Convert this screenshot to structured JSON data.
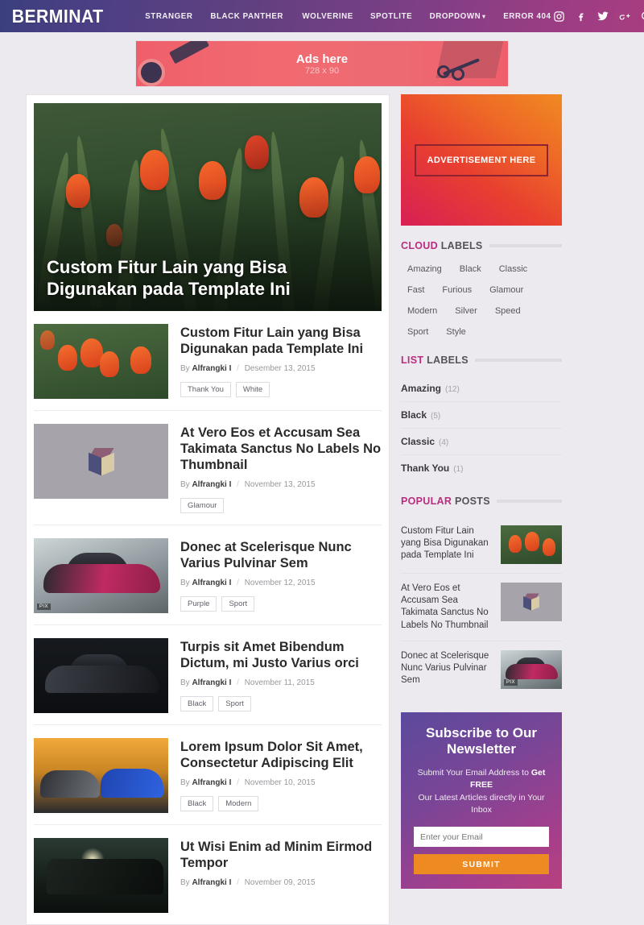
{
  "header": {
    "logo": "BERMINAT",
    "nav": [
      {
        "label": "STRANGER",
        "has_caret": false
      },
      {
        "label": "BLACK PANTHER",
        "has_caret": false
      },
      {
        "label": "WOLVERINE",
        "has_caret": false
      },
      {
        "label": "SPOTLITE",
        "has_caret": false
      },
      {
        "label": "DROPDOWN",
        "has_caret": true
      },
      {
        "label": "ERROR 404",
        "has_caret": false
      }
    ],
    "social": [
      "instagram-icon",
      "facebook-icon",
      "twitter-icon",
      "google-plus-icon",
      "search-icon"
    ],
    "colors": {
      "left": "#3b3f7d",
      "mid": "#604080",
      "right": "#a83d80"
    }
  },
  "top_ad": {
    "title": "Ads here",
    "size": "728 x 90"
  },
  "featured": {
    "title": "Custom Fitur Lain yang Bisa Digunakan pada Template Ini"
  },
  "posts": [
    {
      "title": "Custom Fitur Lain yang Bisa Digunakan pada Template Ini",
      "by": "By",
      "author": "Alfrangki I",
      "date": "Desember 13, 2015",
      "tags": [
        "Thank You",
        "White"
      ],
      "thumb": "tulips-image"
    },
    {
      "title": "At Vero Eos et Accusam Sea Takimata Sanctus No Labels No Thumbnail",
      "by": "By",
      "author": "Alfrangki I",
      "date": "November 13, 2015",
      "tags": [
        "Glamour"
      ],
      "thumb": "cube-placeholder-image"
    },
    {
      "title": "Donec at Scelerisque Nunc Varius Pulvinar Sem",
      "by": "By",
      "author": "Alfrangki I",
      "date": "November 12, 2015",
      "tags": [
        "Purple",
        "Sport"
      ],
      "thumb": "pink-sportscar-image"
    },
    {
      "title": "Turpis sit Amet Bibendum Dictum, mi Justo Varius orci",
      "by": "By",
      "author": "Alfrangki I",
      "date": "November 11, 2015",
      "tags": [
        "Black",
        "Sport"
      ],
      "thumb": "black-sportscar-image"
    },
    {
      "title": "Lorem Ipsum Dolor Sit Amet, Consectetur Adipiscing Elit",
      "by": "By",
      "author": "Alfrangki I",
      "date": "November 10, 2015",
      "tags": [
        "Black",
        "Modern"
      ],
      "thumb": "two-cars-image"
    },
    {
      "title": "Ut Wisi Enim ad Minim Eirmod Tempor",
      "by": "By",
      "author": "Alfrangki I",
      "date": "November 09, 2015",
      "tags": [],
      "thumb": "classic-car-image"
    }
  ],
  "sidebar": {
    "ad": {
      "label": "ADVERTISEMENT HERE"
    },
    "cloud_labels": {
      "title_highlight": "CLOUD",
      "title_rest": "LABELS",
      "items": [
        "Amazing",
        "Black",
        "Classic",
        "Fast",
        "Furious",
        "Glamour",
        "Modern",
        "Silver",
        "Speed",
        "Sport",
        "Style"
      ]
    },
    "list_labels": {
      "title_highlight": "LIST",
      "title_rest": "LABELS",
      "items": [
        {
          "name": "Amazing",
          "count": "(12)"
        },
        {
          "name": "Black",
          "count": "(5)"
        },
        {
          "name": "Classic",
          "count": "(4)"
        },
        {
          "name": "Thank You",
          "count": "(1)"
        }
      ]
    },
    "popular_posts": {
      "title_highlight": "POPULAR",
      "title_rest": "POSTS",
      "items": [
        {
          "title": "Custom Fitur Lain yang Bisa Digunakan pada Template Ini",
          "thumb": "tulips-image"
        },
        {
          "title": "At Vero Eos et Accusam Sea Takimata Sanctus No Labels No Thumbnail",
          "thumb": "cube-placeholder-image"
        },
        {
          "title": "Donec at Scelerisque Nunc Varius Pulvinar Sem",
          "thumb": "pink-sportscar-image"
        }
      ]
    },
    "newsletter": {
      "title": "Subscribe to Our Newsletter",
      "sub_line1_a": "Submit Your Email Address to ",
      "sub_line1_b": "Get FREE",
      "sub_line2": "Our Latest Articles directly in Your Inbox",
      "placeholder": "Enter your Email",
      "button": "SUBMIT",
      "button_color": "#ee8a22"
    }
  }
}
